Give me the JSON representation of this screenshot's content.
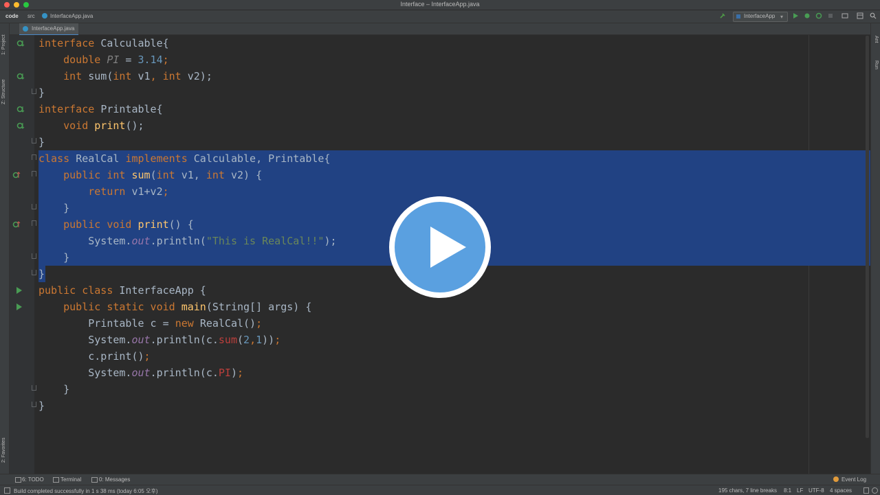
{
  "window": {
    "title": "Interface – InterfaceApp.java"
  },
  "nav": {
    "crumbs": [
      "code",
      "src",
      "InterfaceApp.java"
    ],
    "run_config": "InterfaceApp"
  },
  "left_tools": [
    "1: Project",
    "Z: Structure",
    "2: Favorites"
  ],
  "right_tools": [
    "Ant",
    "Run"
  ],
  "editor": {
    "tab": "InterfaceApp.java",
    "lines": [
      {
        "p": [
          {
            "t": "interface ",
            "c": "kw"
          },
          {
            "t": "Calculable{",
            "c": ""
          }
        ]
      },
      {
        "p": [
          {
            "t": "    double ",
            "c": "kw"
          },
          {
            "t": "PI",
            "c": "dim"
          },
          {
            "t": " = ",
            "c": ""
          },
          {
            "t": "3.14",
            "c": "num"
          },
          {
            "t": ";",
            "c": "kw"
          }
        ]
      },
      {
        "p": [
          {
            "t": "    int ",
            "c": "kw"
          },
          {
            "t": "sum",
            "c": ""
          },
          {
            "t": "(",
            "c": ""
          },
          {
            "t": "int ",
            "c": "kw"
          },
          {
            "t": "v1",
            "c": ""
          },
          {
            "t": ", ",
            "c": "kw"
          },
          {
            "t": "int ",
            "c": "kw"
          },
          {
            "t": "v2);",
            "c": ""
          }
        ]
      },
      {
        "p": [
          {
            "t": "}",
            "c": ""
          }
        ]
      },
      {
        "p": [
          {
            "t": "interface ",
            "c": "kw"
          },
          {
            "t": "Printable{",
            "c": ""
          }
        ]
      },
      {
        "p": [
          {
            "t": "    void ",
            "c": "kw"
          },
          {
            "t": "print",
            "c": "fn"
          },
          {
            "t": "();",
            "c": ""
          }
        ]
      },
      {
        "p": [
          {
            "t": "}",
            "c": ""
          }
        ]
      },
      {
        "p": [
          {
            "t": "class ",
            "c": "kw"
          },
          {
            "t": "RealCal ",
            "c": ""
          },
          {
            "t": "implements ",
            "c": "kw"
          },
          {
            "t": "Calculable, Printable{",
            "c": ""
          }
        ]
      },
      {
        "p": [
          {
            "t": "    public int ",
            "c": "kw"
          },
          {
            "t": "sum",
            "c": "fn"
          },
          {
            "t": "(",
            "c": ""
          },
          {
            "t": "int ",
            "c": "kw"
          },
          {
            "t": "v1, ",
            "c": ""
          },
          {
            "t": "int ",
            "c": "kw"
          },
          {
            "t": "v2) {",
            "c": ""
          }
        ]
      },
      {
        "p": [
          {
            "t": "        return ",
            "c": "kw"
          },
          {
            "t": "v1+v2",
            "c": ""
          },
          {
            "t": ";",
            "c": "kw"
          }
        ]
      },
      {
        "p": [
          {
            "t": "    }",
            "c": ""
          }
        ]
      },
      {
        "p": [
          {
            "t": "    public void ",
            "c": "kw"
          },
          {
            "t": "print",
            "c": "fn"
          },
          {
            "t": "() {",
            "c": ""
          }
        ]
      },
      {
        "p": [
          {
            "t": "        System.",
            "c": ""
          },
          {
            "t": "out",
            "c": "fld"
          },
          {
            "t": ".println(",
            "c": ""
          },
          {
            "t": "\"This is RealCal!!\"",
            "c": "str"
          },
          {
            "t": ");",
            "c": ""
          }
        ]
      },
      {
        "p": [
          {
            "t": "    }",
            "c": ""
          }
        ]
      },
      {
        "p": [
          {
            "t": "}",
            "c": ""
          }
        ]
      },
      {
        "p": [
          {
            "t": "public class ",
            "c": "kw"
          },
          {
            "t": "InterfaceApp {",
            "c": ""
          }
        ]
      },
      {
        "p": [
          {
            "t": "    public static void ",
            "c": "kw"
          },
          {
            "t": "main",
            "c": "fn"
          },
          {
            "t": "(String[] args) {",
            "c": ""
          }
        ]
      },
      {
        "p": [
          {
            "t": "        Printable c = ",
            "c": ""
          },
          {
            "t": "new ",
            "c": "kw"
          },
          {
            "t": "RealCal()",
            "c": ""
          },
          {
            "t": ";",
            "c": "kw"
          }
        ]
      },
      {
        "p": [
          {
            "t": "        System.",
            "c": ""
          },
          {
            "t": "out",
            "c": "fld"
          },
          {
            "t": ".println(c.",
            "c": ""
          },
          {
            "t": "sum",
            "c": "ref"
          },
          {
            "t": "(",
            "c": ""
          },
          {
            "t": "2",
            "c": "num"
          },
          {
            "t": ",",
            "c": "kw"
          },
          {
            "t": "1",
            "c": "num"
          },
          {
            "t": "))",
            "c": ""
          },
          {
            "t": ";",
            "c": "kw"
          }
        ]
      },
      {
        "p": [
          {
            "t": "        c.print()",
            "c": ""
          },
          {
            "t": ";",
            "c": "kw"
          }
        ]
      },
      {
        "p": [
          {
            "t": "        System.",
            "c": ""
          },
          {
            "t": "out",
            "c": "fld"
          },
          {
            "t": ".println(c.",
            "c": ""
          },
          {
            "t": "PI",
            "c": "ref"
          },
          {
            "t": ")",
            "c": ""
          },
          {
            "t": ";",
            "c": "kw"
          }
        ]
      },
      {
        "p": [
          {
            "t": "    }",
            "c": ""
          }
        ]
      },
      {
        "p": [
          {
            "t": "}",
            "c": ""
          }
        ]
      }
    ]
  },
  "tool_windows": [
    "6: TODO",
    "Terminal",
    "0: Messages"
  ],
  "event_log": "Event Log",
  "status": {
    "message": "Build completed successfully in 1 s 38 ms (today 6:05 오후)",
    "chars": "195 chars, 7 line breaks",
    "position": "8:1",
    "line_sep": "LF",
    "encoding": "UTF-8",
    "indent": "4 spaces"
  },
  "colors": {
    "keyword": "#cc7832",
    "number": "#6897bb",
    "string": "#6a8759",
    "field": "#9876aa",
    "selection": "#214283",
    "play_button": "#5aa0e0"
  }
}
